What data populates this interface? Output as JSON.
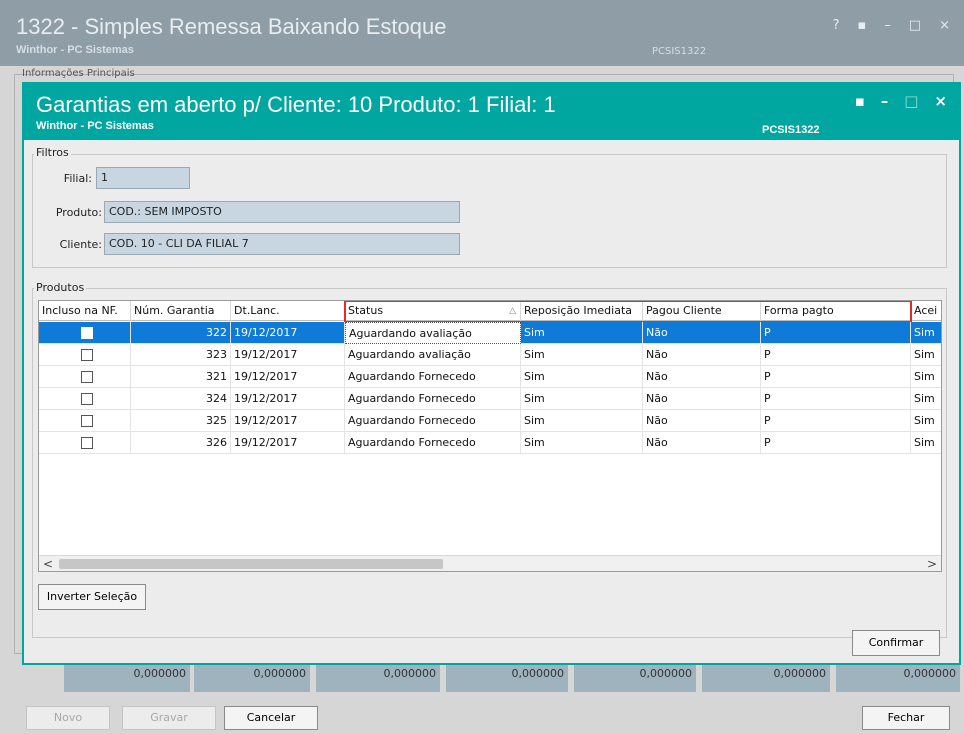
{
  "background_window": {
    "title": "1322 - Simples Remessa Baixando Estoque",
    "subtitle": "Winthor - PC Sistemas",
    "code": "PCSIS1322",
    "group_label": "Informações Principais",
    "controls": [
      "?",
      "▪",
      "–",
      "□",
      "×"
    ],
    "totals": [
      "0,000000",
      "0,000000",
      "0,000000",
      "0,000000",
      "0,000000",
      "0,000000",
      "0,000000"
    ],
    "buttons": {
      "novo": "Novo",
      "gravar": "Gravar",
      "cancelar": "Cancelar",
      "fechar": "Fechar"
    }
  },
  "dialog": {
    "title": "Garantias em aberto p/ Cliente: 10  Produto: 1  Filial:  1",
    "subtitle": "Winthor - PC Sistemas",
    "code": "PCSIS1322",
    "controls": [
      "▪",
      "–",
      "□",
      "×"
    ],
    "accent_color": "#00a7a0",
    "filters": {
      "label": "Filtros",
      "filial_label": "Filial:",
      "filial_value": "1",
      "produto_label": "Produto:",
      "produto_value": "COD.: SEM IMPOSTO",
      "cliente_label": "Cliente:",
      "cliente_value": "COD. 10 - CLI DA FILIAL 7"
    },
    "products": {
      "label": "Produtos",
      "columns": [
        "Incluso na NF.",
        "Núm. Garantia",
        "Dt.Lanc.",
        "Status",
        "Reposição Imediata",
        "Pagou Cliente",
        "Forma pagto",
        "Acei"
      ],
      "rows": [
        {
          "incluso": false,
          "num": "322",
          "dt": "19/12/2017",
          "status": "Aguardando avaliação",
          "reposicao": "Sim",
          "pagou": "Não",
          "forma": "P",
          "aceite": "Sim",
          "selected": true
        },
        {
          "incluso": false,
          "num": "323",
          "dt": "19/12/2017",
          "status": "Aguardando avaliação",
          "reposicao": "Sim",
          "pagou": "Não",
          "forma": "P",
          "aceite": "Sim",
          "selected": false
        },
        {
          "incluso": false,
          "num": "321",
          "dt": "19/12/2017",
          "status": "Aguardando Fornecedo",
          "reposicao": "Sim",
          "pagou": "Não",
          "forma": "P",
          "aceite": "Sim",
          "selected": false
        },
        {
          "incluso": false,
          "num": "324",
          "dt": "19/12/2017",
          "status": "Aguardando Fornecedo",
          "reposicao": "Sim",
          "pagou": "Não",
          "forma": "P",
          "aceite": "Sim",
          "selected": false
        },
        {
          "incluso": false,
          "num": "325",
          "dt": "19/12/2017",
          "status": "Aguardando Fornecedo",
          "reposicao": "Sim",
          "pagou": "Não",
          "forma": "P",
          "aceite": "Sim",
          "selected": false
        },
        {
          "incluso": false,
          "num": "326",
          "dt": "19/12/2017",
          "status": "Aguardando Fornecedo",
          "reposicao": "Sim",
          "pagou": "Não",
          "forma": "P",
          "aceite": "Sim",
          "selected": false
        }
      ],
      "scroll_left": "<",
      "scroll_right": ">"
    },
    "buttons": {
      "inverter": "Inverter Seleção",
      "confirmar": "Confirmar"
    }
  }
}
